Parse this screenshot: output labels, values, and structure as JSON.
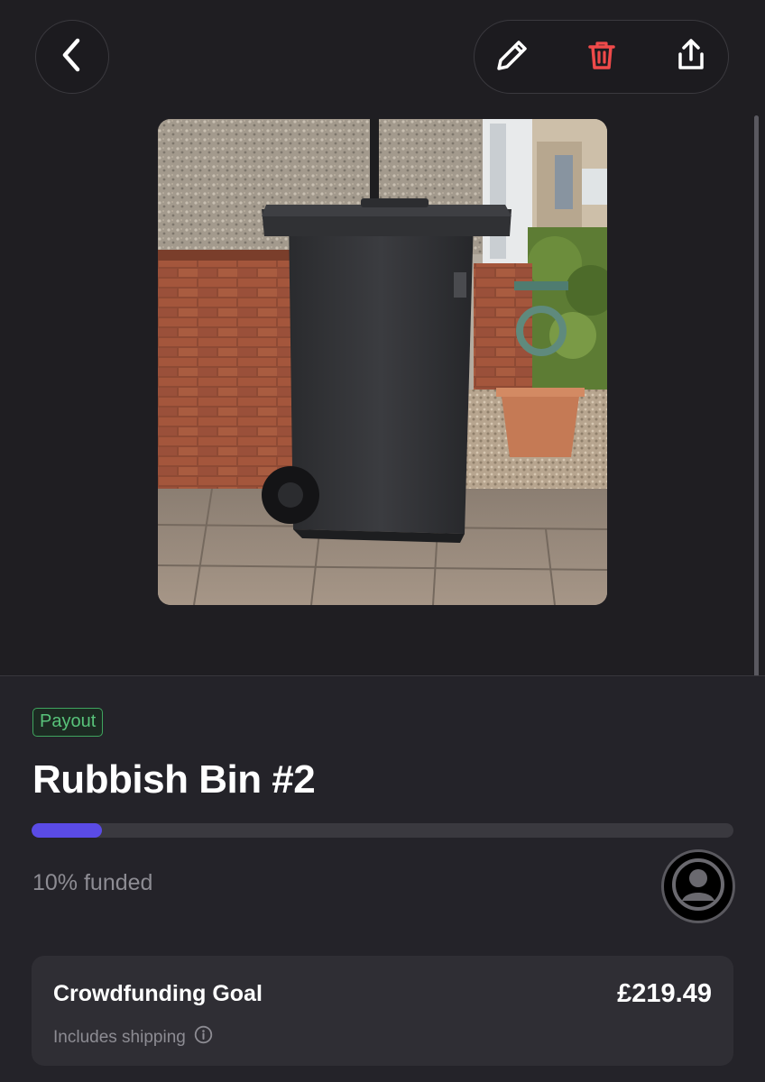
{
  "header": {
    "back_icon": "chevron-left-icon",
    "actions": [
      {
        "name": "edit",
        "icon": "pencil-icon",
        "color": "#ffffff"
      },
      {
        "name": "delete",
        "icon": "trash-icon",
        "color": "#ef4a4a"
      },
      {
        "name": "share",
        "icon": "share-icon",
        "color": "#ffffff"
      }
    ]
  },
  "product": {
    "image_description": "Dark grey wheelie rubbish bin beside a brick house on a paved path",
    "badge": "Payout",
    "badge_color": "#58c37a",
    "title": "Rubbish Bin #2",
    "funded_fraction": 0.1,
    "funded_text": "10% funded",
    "progress_color": "#5a4be6"
  },
  "goal": {
    "label": "Crowdfunding Goal",
    "amount": "£219.49",
    "subtext": "Includes shipping",
    "info_icon": "info-icon"
  }
}
